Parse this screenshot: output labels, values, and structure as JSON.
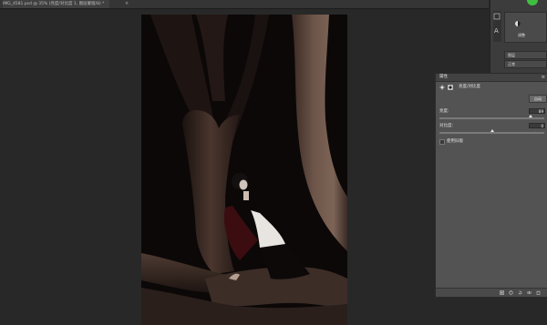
{
  "document": {
    "tab_label": "IMG_4581.psd @ 35% (亮度/对比度 1, 图层蒙版/8) *",
    "close_glyph": "×"
  },
  "dock": {
    "adjustments_label": "调整",
    "blend_mode": "正常",
    "layer_hint": "图层"
  },
  "properties": {
    "title": "属性",
    "menu_glyph": "≡",
    "adjustment_type": "亮度/对比度",
    "auto_button": "自动",
    "brightness_label": "亮度:",
    "brightness_value": "89",
    "brightness_level": 0.87,
    "contrast_label": "对比度:",
    "contrast_value": "0",
    "contrast_level": 0.5,
    "legacy_label": "使用旧版"
  },
  "colors": {
    "workspace": "#282828",
    "panel": "#535353",
    "badge": "#3fbf3f"
  }
}
